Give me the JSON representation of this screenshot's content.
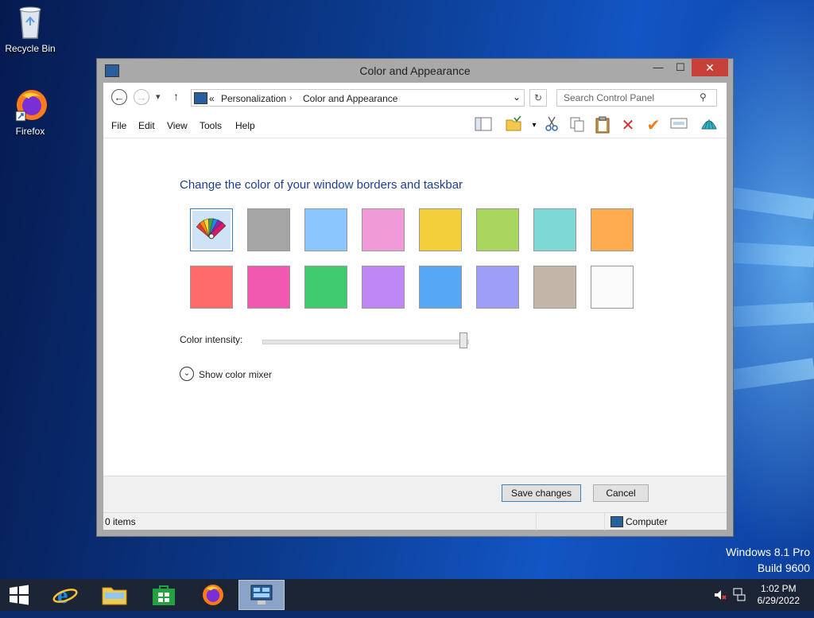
{
  "desktop": {
    "icons": [
      {
        "label": "Recycle Bin",
        "icon": "recycle-bin-icon"
      },
      {
        "label": "Firefox",
        "icon": "firefox-icon"
      }
    ],
    "watermark_line1": "Windows 8.1 Pro",
    "watermark_line2": "Build 9600"
  },
  "window": {
    "title": "Color and Appearance",
    "controls": {
      "minimize": "—",
      "maximize": "☐",
      "close": "✕"
    },
    "nav": {
      "back": "←",
      "forward": "→",
      "recent": "▾",
      "up": "↑",
      "breadcrumb_prefix": "«",
      "breadcrumbs": [
        "Personalization",
        "Color and Appearance"
      ],
      "address_dropdown": "⌄",
      "refresh": "↻",
      "search_placeholder": "Search Control Panel",
      "search_icon": "⚲"
    },
    "menu": [
      "File",
      "Edit",
      "View",
      "Tools",
      "Help"
    ],
    "toolbar_icons": [
      "layout-icon",
      "folder-options-icon",
      "dropdown-icon",
      "cut-icon",
      "copy-icon",
      "paste-icon",
      "delete-icon",
      "properties-icon",
      "rename-icon",
      "shell-icon"
    ],
    "heading": "Change the color of your window borders and taskbar",
    "swatches": [
      {
        "name": "automatic",
        "color": "#cfe3f7",
        "selected": true
      },
      {
        "name": "slate",
        "color": "#a5a5a5"
      },
      {
        "name": "sky",
        "color": "#8cc6ff"
      },
      {
        "name": "pink",
        "color": "#f09bd8"
      },
      {
        "name": "yellow",
        "color": "#f2cf3a"
      },
      {
        "name": "lime",
        "color": "#a9d65e"
      },
      {
        "name": "teal",
        "color": "#7ed8d6"
      },
      {
        "name": "orange",
        "color": "#ffab4f"
      },
      {
        "name": "red",
        "color": "#ff6b6b"
      },
      {
        "name": "magenta",
        "color": "#f159b1"
      },
      {
        "name": "green",
        "color": "#3fcb6e"
      },
      {
        "name": "violet",
        "color": "#bf87f5"
      },
      {
        "name": "blue",
        "color": "#56a8f5"
      },
      {
        "name": "periwinkle",
        "color": "#9e9ef8"
      },
      {
        "name": "taupe",
        "color": "#c3b5a8"
      },
      {
        "name": "white",
        "color": "#fbfbfb"
      }
    ],
    "intensity_label": "Color intensity:",
    "intensity_value": 1.0,
    "mixer_label": "Show color mixer",
    "mixer_icon": "⌄",
    "save_label": "Save changes",
    "cancel_label": "Cancel",
    "status_items": "0 items",
    "status_location": "Computer"
  },
  "taskbar": {
    "start_icon": "windows-start-icon",
    "pinned": [
      "internet-explorer-icon",
      "file-explorer-icon",
      "store-icon",
      "firefox-icon",
      "control-panel-icon"
    ],
    "active": "control-panel-icon",
    "time": "1:02 PM",
    "date": "6/29/2022"
  },
  "colors": {
    "heading": "#1e3f8f",
    "close_button": "#c7403a",
    "taskbar": "#1c2536"
  }
}
